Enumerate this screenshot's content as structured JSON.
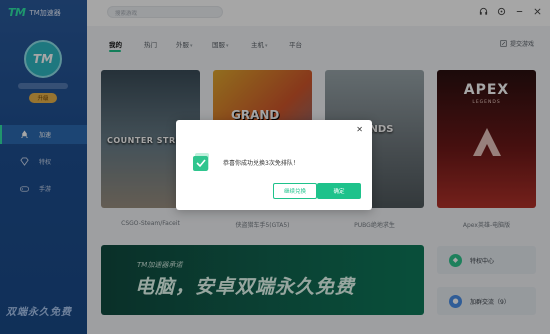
{
  "app": {
    "logo": "TM",
    "name": "TM加速器"
  },
  "user": {
    "avatar_text": "TM",
    "vip_label": "升级"
  },
  "sidebar": {
    "items": [
      {
        "label": "加速",
        "icon": "rocket-icon",
        "active": true
      },
      {
        "label": "特权",
        "icon": "diamond-icon",
        "active": false
      },
      {
        "label": "手游",
        "icon": "gamepad-icon",
        "active": false
      }
    ],
    "slogan": "双端永久免费"
  },
  "search": {
    "placeholder": "搜索游戏"
  },
  "tabs": [
    {
      "label": "我的",
      "active": true
    },
    {
      "label": "热门"
    },
    {
      "label": "外服"
    },
    {
      "label": "国服"
    },
    {
      "label": "主机"
    },
    {
      "label": "平台"
    }
  ],
  "feedback_label": "提交游戏",
  "games": [
    {
      "name": "CSGO-Steam/Faceit",
      "art_text": "COUNTER STRIKE"
    },
    {
      "name": "侠盗猎车手5(GTA5)",
      "art_text": "GRAND"
    },
    {
      "name": "PUBG绝地求生",
      "art_text": "GROUNDS"
    },
    {
      "name": "Apex英雄-电脑版",
      "art_text": "APEX",
      "art_sub": "LEGENDS"
    }
  ],
  "banner": {
    "small": "TM加速器承诺",
    "big": "电脑，安卓双端永久免费"
  },
  "side_buttons": [
    {
      "label": "特权中心",
      "icon": "diamond-icon",
      "color": "#2fc58e"
    },
    {
      "label": "加群交流（9）",
      "icon": "chat-icon",
      "color": "#4a8fe8"
    }
  ],
  "dialog": {
    "message": "恭喜你成功兑换3次免排队！",
    "secondary_button": "继续兑换",
    "primary_button": "确定"
  },
  "colors": {
    "accent": "#1ec28b",
    "sidebar": "#1e4f91"
  }
}
